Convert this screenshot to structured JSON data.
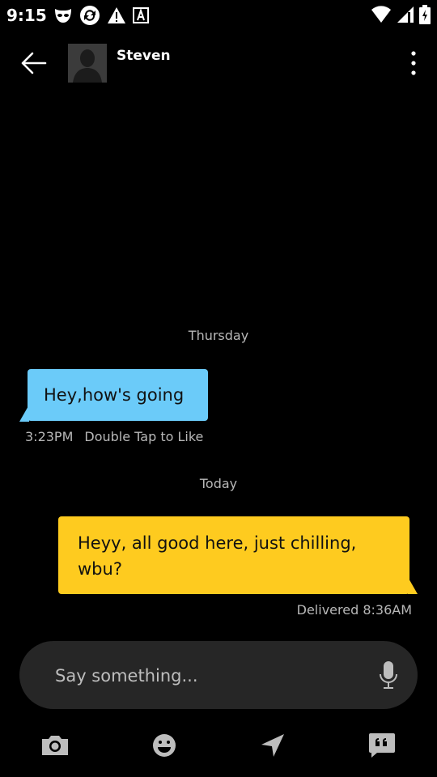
{
  "status_bar": {
    "time": "9:15",
    "left_icons": [
      "grindr-mask-icon",
      "sync-icon",
      "warning-icon",
      "font-a-icon"
    ],
    "right_icons": [
      "wifi-icon",
      "cellular-signal-icon",
      "battery-icon"
    ]
  },
  "header": {
    "contact_name": "Steven"
  },
  "conversation": {
    "thursday_label": "Thursday",
    "incoming": {
      "text": "Hey,how's going",
      "time": "3:23PM",
      "hint": "Double Tap to Like"
    },
    "today_label": "Today",
    "outgoing": {
      "text": "Heyy, all good here, just chilling, wbu?",
      "status": "Delivered 8:36AM"
    }
  },
  "composer": {
    "placeholder": "Say something..."
  },
  "toolbar": {
    "items": [
      "camera-icon",
      "emoji-icon",
      "location-send-icon",
      "saved-phrases-icon"
    ]
  },
  "colors": {
    "background": "#000000",
    "incoming_bubble": "#6bcbf9",
    "outgoing_bubble": "#fecb1f",
    "composer_bg": "#262626",
    "meta_text": "#b8b8b8"
  }
}
